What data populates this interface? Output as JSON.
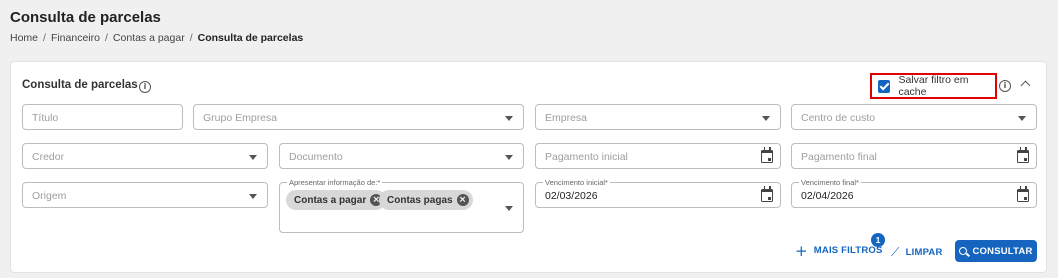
{
  "page": {
    "title": "Consulta de parcelas"
  },
  "breadcrumb": {
    "items": [
      "Home",
      "Financeiro",
      "Contas a pagar"
    ],
    "current": "Consulta de parcelas",
    "separator": "/"
  },
  "card": {
    "title": "Consulta de parcelas",
    "save_cache_label": "Salvar filtro em cache",
    "save_cache_checked": true
  },
  "filters": {
    "titulo": {
      "placeholder": "Título"
    },
    "grupo_empresa": {
      "placeholder": "Grupo Empresa"
    },
    "empresa": {
      "placeholder": "Empresa"
    },
    "centro_custo": {
      "placeholder": "Centro de custo"
    },
    "credor": {
      "placeholder": "Credor"
    },
    "documento": {
      "placeholder": "Documento"
    },
    "pagamento_inicial": {
      "placeholder": "Pagamento inicial"
    },
    "pagamento_final": {
      "placeholder": "Pagamento final"
    },
    "origem": {
      "placeholder": "Origem"
    },
    "apresentar": {
      "label": "Apresentar informação de:*",
      "chips": [
        "Contas a pagar",
        "Contas pagas"
      ]
    },
    "vencimento_inicial": {
      "label": "Vencimento inicial*",
      "value": "02/03/2026"
    },
    "vencimento_final": {
      "label": "Vencimento final*",
      "value": "02/04/2026"
    }
  },
  "actions": {
    "mais_filtros": "MAIS FILTROS",
    "mais_filtros_badge": "1",
    "limpar": "LIMPAR",
    "consultar": "CONSULTAR"
  },
  "colors": {
    "accent": "#1565c0",
    "highlight_border": "#e10000"
  }
}
